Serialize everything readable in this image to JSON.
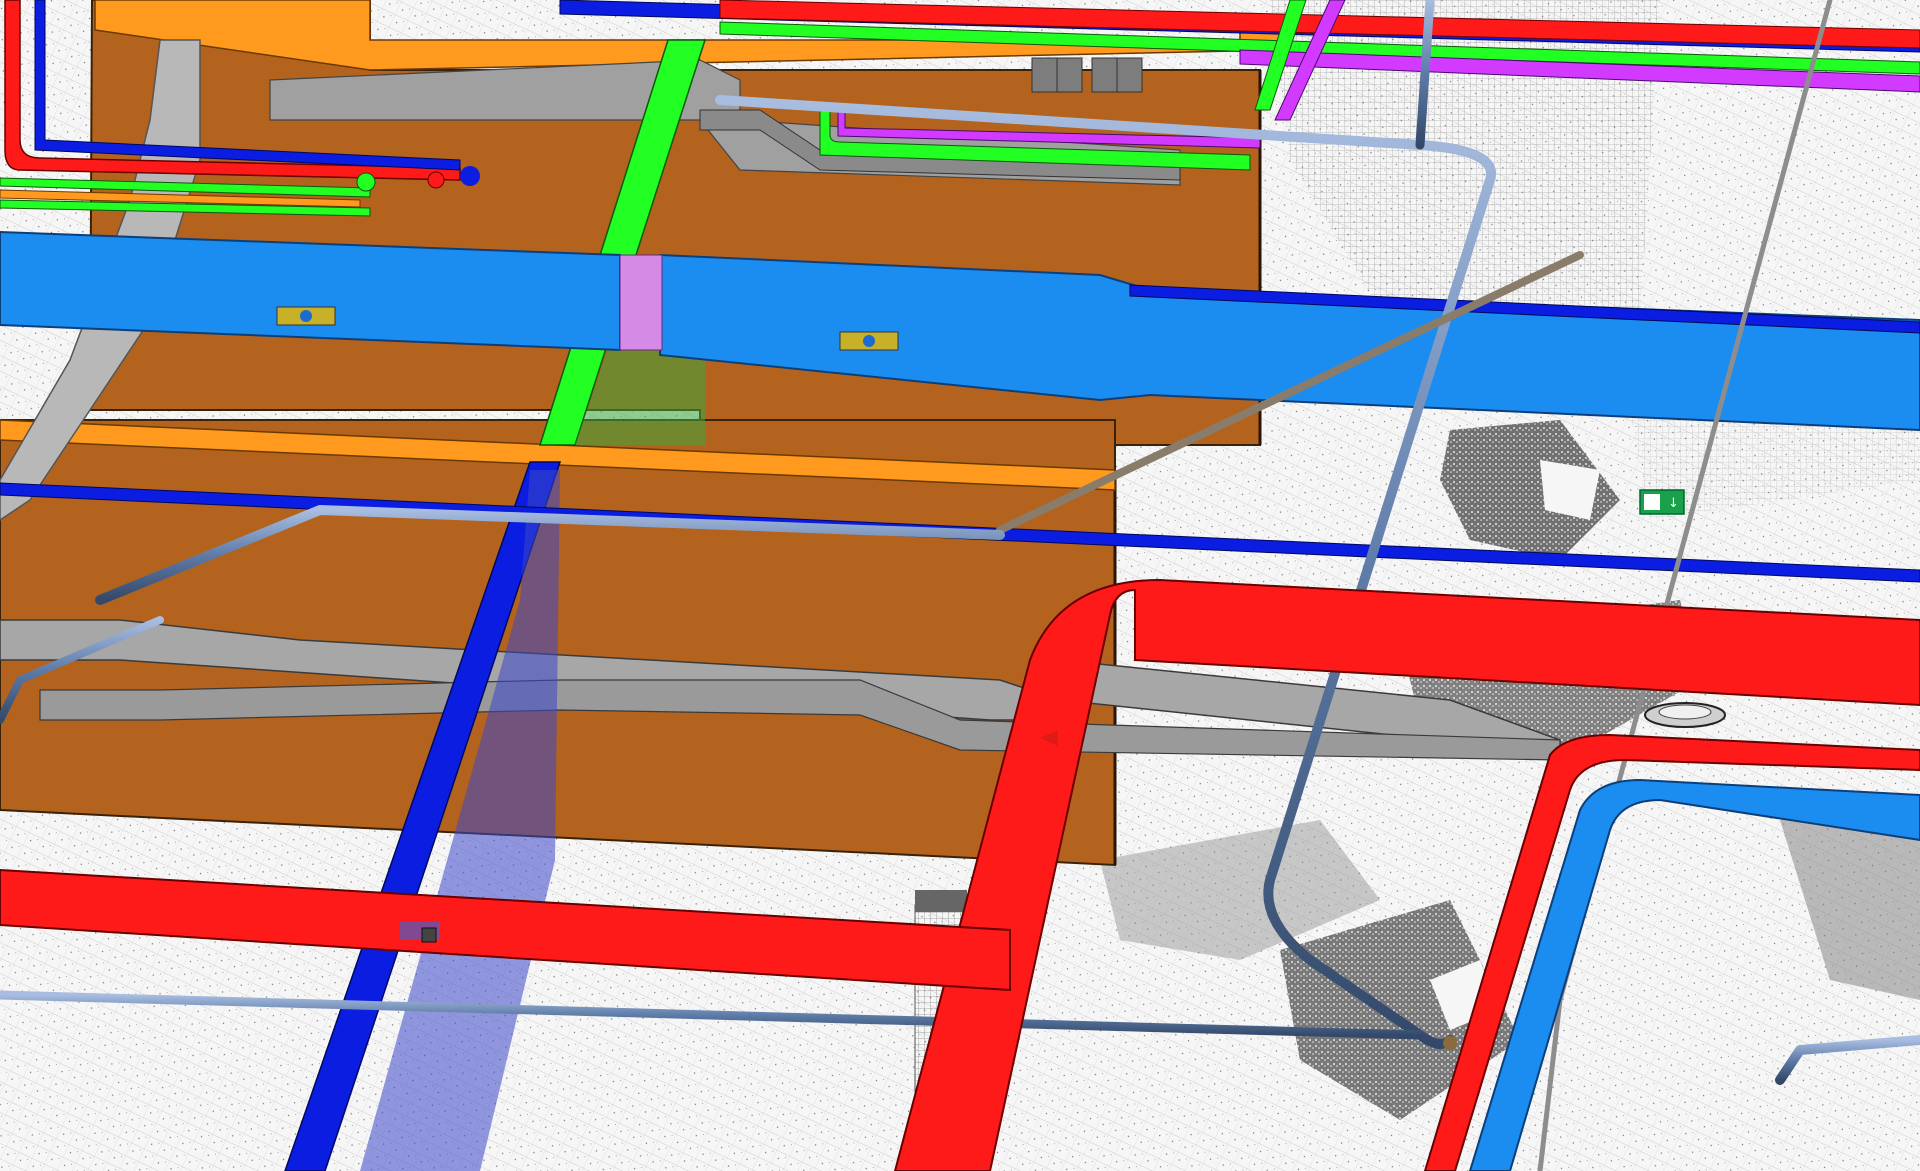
{
  "view": {
    "kind": "BIM MEP model over point cloud",
    "background": "#f4f4f4",
    "pointcloud_color": "#8a8a8a"
  },
  "colors": {
    "wall": "#b3631e",
    "wall_edge": "#3a2208",
    "beam": "#ff9a1f",
    "heating_pipe": "#ff1a1a",
    "supply_duct": "#1b8cf0",
    "cold_pipe": "#0a1de0",
    "green_pipe": "#22ff22",
    "purple_pipe": "#d23bff",
    "steel_pipe": "#5e7ca8",
    "cable_tray": "#9a9a9a",
    "exit_sign": "#1aa04a"
  },
  "icons": {
    "exit_sign": "emergency-exit-sign-icon"
  }
}
